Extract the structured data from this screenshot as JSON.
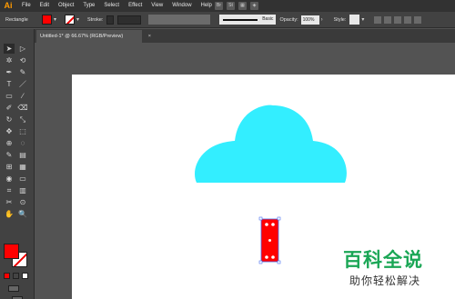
{
  "app": {
    "logo": "Ai",
    "accent_color": "#ff9a00"
  },
  "menu": [
    "File",
    "Edit",
    "Object",
    "Type",
    "Select",
    "Effect",
    "View",
    "Window",
    "Help"
  ],
  "menu_right_icons": [
    "bridge-icon",
    "stock-icon",
    "arrange-icon",
    "gpu-icon"
  ],
  "menu_right_labels": [
    "Br",
    "St",
    "",
    ""
  ],
  "control_bar": {
    "object_label": "Rectangle",
    "fill_color": "#ff0000",
    "stroke_label": "Stroke:",
    "brush_label": "Basic",
    "opacity_label": "Opacity:",
    "opacity_value": "100%",
    "style_label": "Style:"
  },
  "document_tab": {
    "title": "Untitled-1* @ 66.67% (RGB/Preview)",
    "close": "×"
  },
  "tools": {
    "glyphs": [
      "➤",
      "▷",
      "✲",
      "⟲",
      "✒",
      "✎",
      "T",
      "／",
      "▭",
      "∕",
      "✐",
      "⌫",
      "↻",
      "⤡",
      "✥",
      "⬚",
      "⊕",
      "◌",
      "✎",
      "▤",
      "⊞",
      "▦",
      "◉",
      "▭",
      "⌗",
      "▥",
      "✂",
      "⊙",
      "✋",
      "🔍"
    ]
  },
  "colors": {
    "fill": "#ff0000",
    "stroke": "#ffffff",
    "cloud": "#33eeff",
    "shape_selected": "#ff0000"
  },
  "watermark": {
    "title": "百科全说",
    "subtitle": "助你轻松解决"
  }
}
